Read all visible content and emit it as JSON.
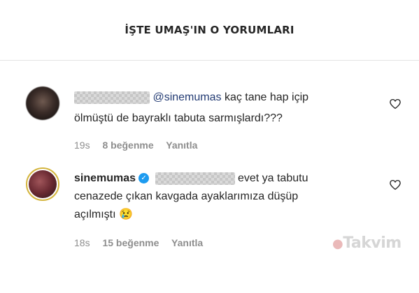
{
  "header": {
    "title": "İŞTE UMAŞ'IN O YORUMLARI"
  },
  "comments": [
    {
      "mention": "@sinemumas",
      "text_line1": " kaç tane hap içip",
      "text_line2": "ölmüştü de bayraklı tabuta sarmışlardı???",
      "time": "19s",
      "likes": "8 beğenme",
      "reply": "Yanıtla"
    },
    {
      "username": "sinemumas",
      "text_line1": " evet ya tabutu",
      "text_line2": "cenazede çıkan kavgada ayaklarımıza düşüp",
      "text_line3": "açılmıştı 😢",
      "time": "18s",
      "likes": "15 beğenme",
      "reply": "Yanıtla"
    }
  ],
  "watermark": "Takvim"
}
